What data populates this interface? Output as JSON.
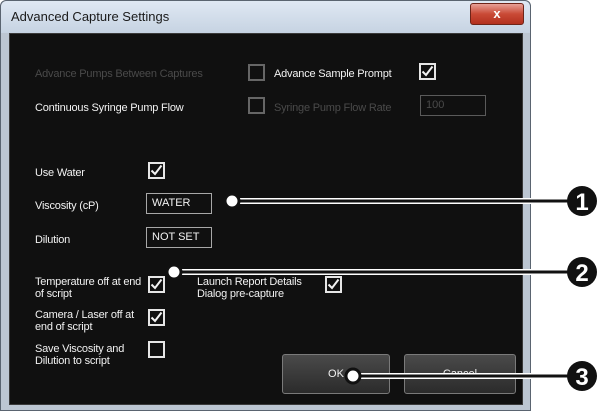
{
  "window": {
    "title": "Advanced Capture Settings",
    "close_glyph": "x"
  },
  "labels": {
    "advance_pumps": "Advance Pumps Between Captures",
    "advance_sample_prompt": "Advance Sample Prompt",
    "continuous_syringe": "Continuous Syringe Pump Flow",
    "syringe_rate": "Syringe Pump Flow Rate",
    "use_water": "Use Water",
    "viscosity": "Viscosity (cP)",
    "dilution": "Dilution",
    "temperature_off": "Temperature off at end of script",
    "launch_report": "Launch Report Details Dialog pre-capture",
    "camera_laser_off": "Camera / Laser off at end of script",
    "save_viscosity": "Save Viscosity and Dilution to script"
  },
  "checkboxes": {
    "advance_pumps": false,
    "advance_sample_prompt": true,
    "syringe_rate": false,
    "use_water": true,
    "temperature_off": true,
    "launch_report": true,
    "camera_laser_off": true,
    "save_viscosity": false
  },
  "fields": {
    "syringe_rate": "100",
    "viscosity": "WATER",
    "dilution": "NOT SET"
  },
  "buttons": {
    "ok": "OK",
    "cancel": "Cancel"
  },
  "callouts": [
    "1",
    "2",
    "3"
  ],
  "colors": {
    "background": "#101010",
    "text": "#f2f2f2",
    "disabled_text": "#4a4a4a",
    "frame": "#bcc6d2",
    "close": "#c94a36"
  }
}
